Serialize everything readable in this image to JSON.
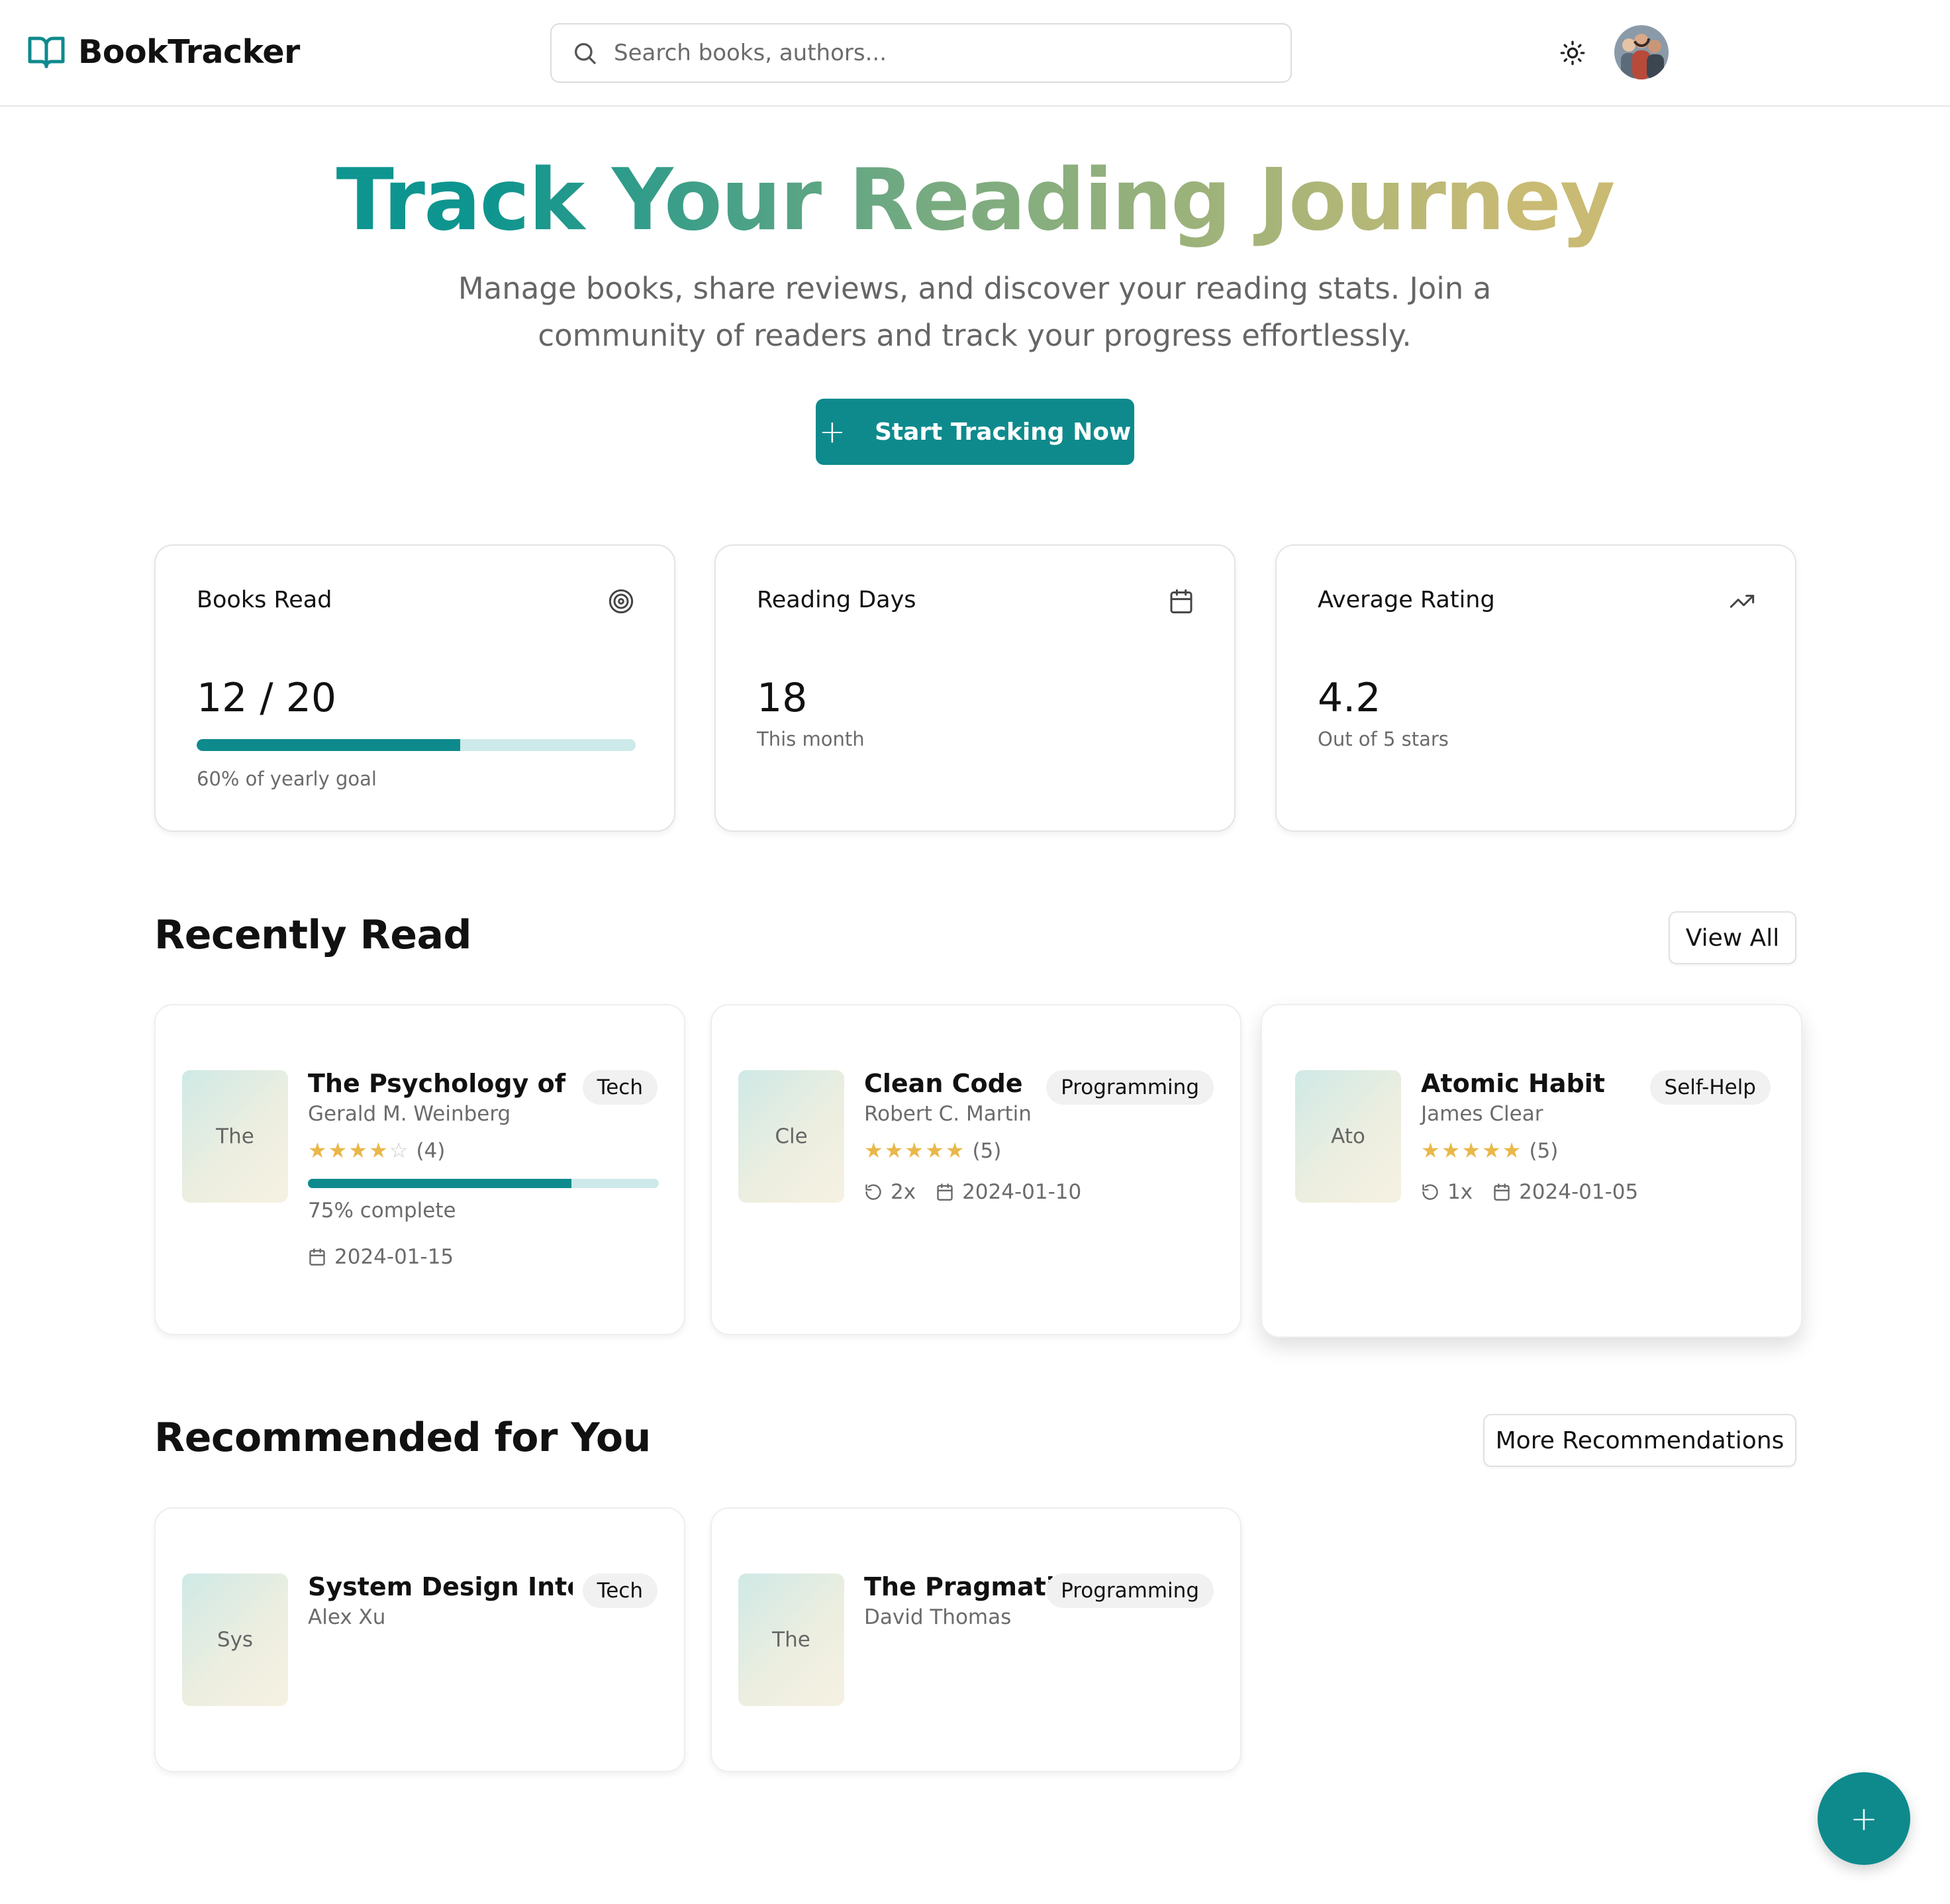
{
  "app": {
    "name": "BookTracker"
  },
  "search": {
    "placeholder": "Search books, authors..."
  },
  "hero": {
    "title": "Track Your Reading Journey",
    "subtitle": "Manage books, share reviews, and discover your reading stats. Join a community of readers and track your progress effortlessly.",
    "cta_label": "Start Tracking Now"
  },
  "stats": {
    "books_read": {
      "title": "Books Read",
      "value": "12 / 20",
      "progress_percent": 60,
      "sub": "60% of yearly goal",
      "icon": "target-icon"
    },
    "reading_days": {
      "title": "Reading Days",
      "value": "18",
      "sub": "This month",
      "icon": "calendar-icon"
    },
    "average_rating": {
      "title": "Average Rating",
      "value": "4.2",
      "sub": "Out of 5 stars",
      "icon": "trending-up-icon"
    }
  },
  "recently_read": {
    "title": "Recently Read",
    "view_all_label": "View All",
    "books": [
      {
        "cover": "The",
        "title": "The Psychology of P...",
        "author": "Gerald M. Weinberg",
        "tag": "Tech",
        "rating": 4,
        "rating_label": "(4)",
        "progress_percent": 75,
        "progress_label": "75% complete",
        "date": "2024-01-15"
      },
      {
        "cover": "Cle",
        "title": "Clean Code",
        "author": "Robert C. Martin",
        "tag": "Programming",
        "rating": 5,
        "rating_label": "(5)",
        "reads": "2x",
        "date": "2024-01-10"
      },
      {
        "cover": "Ato",
        "title": "Atomic Habits",
        "author": "James Clear",
        "tag": "Self-Help",
        "rating": 5,
        "rating_label": "(5)",
        "reads": "1x",
        "date": "2024-01-05"
      }
    ]
  },
  "recommended": {
    "title": "Recommended for You",
    "more_label": "More Recommendations",
    "books": [
      {
        "cover": "Sys",
        "title": "System Design Inter...",
        "author": "Alex Xu",
        "tag": "Tech"
      },
      {
        "cover": "The",
        "title": "The Pragmati...",
        "author": "David Thomas",
        "tag": "Programming"
      }
    ]
  },
  "fab": {
    "label": "+"
  },
  "colors": {
    "accent": "#0e8a8d",
    "star": "#e9b84a",
    "gradient_start": "#0e958f",
    "gradient_end": "#c9bb74"
  }
}
